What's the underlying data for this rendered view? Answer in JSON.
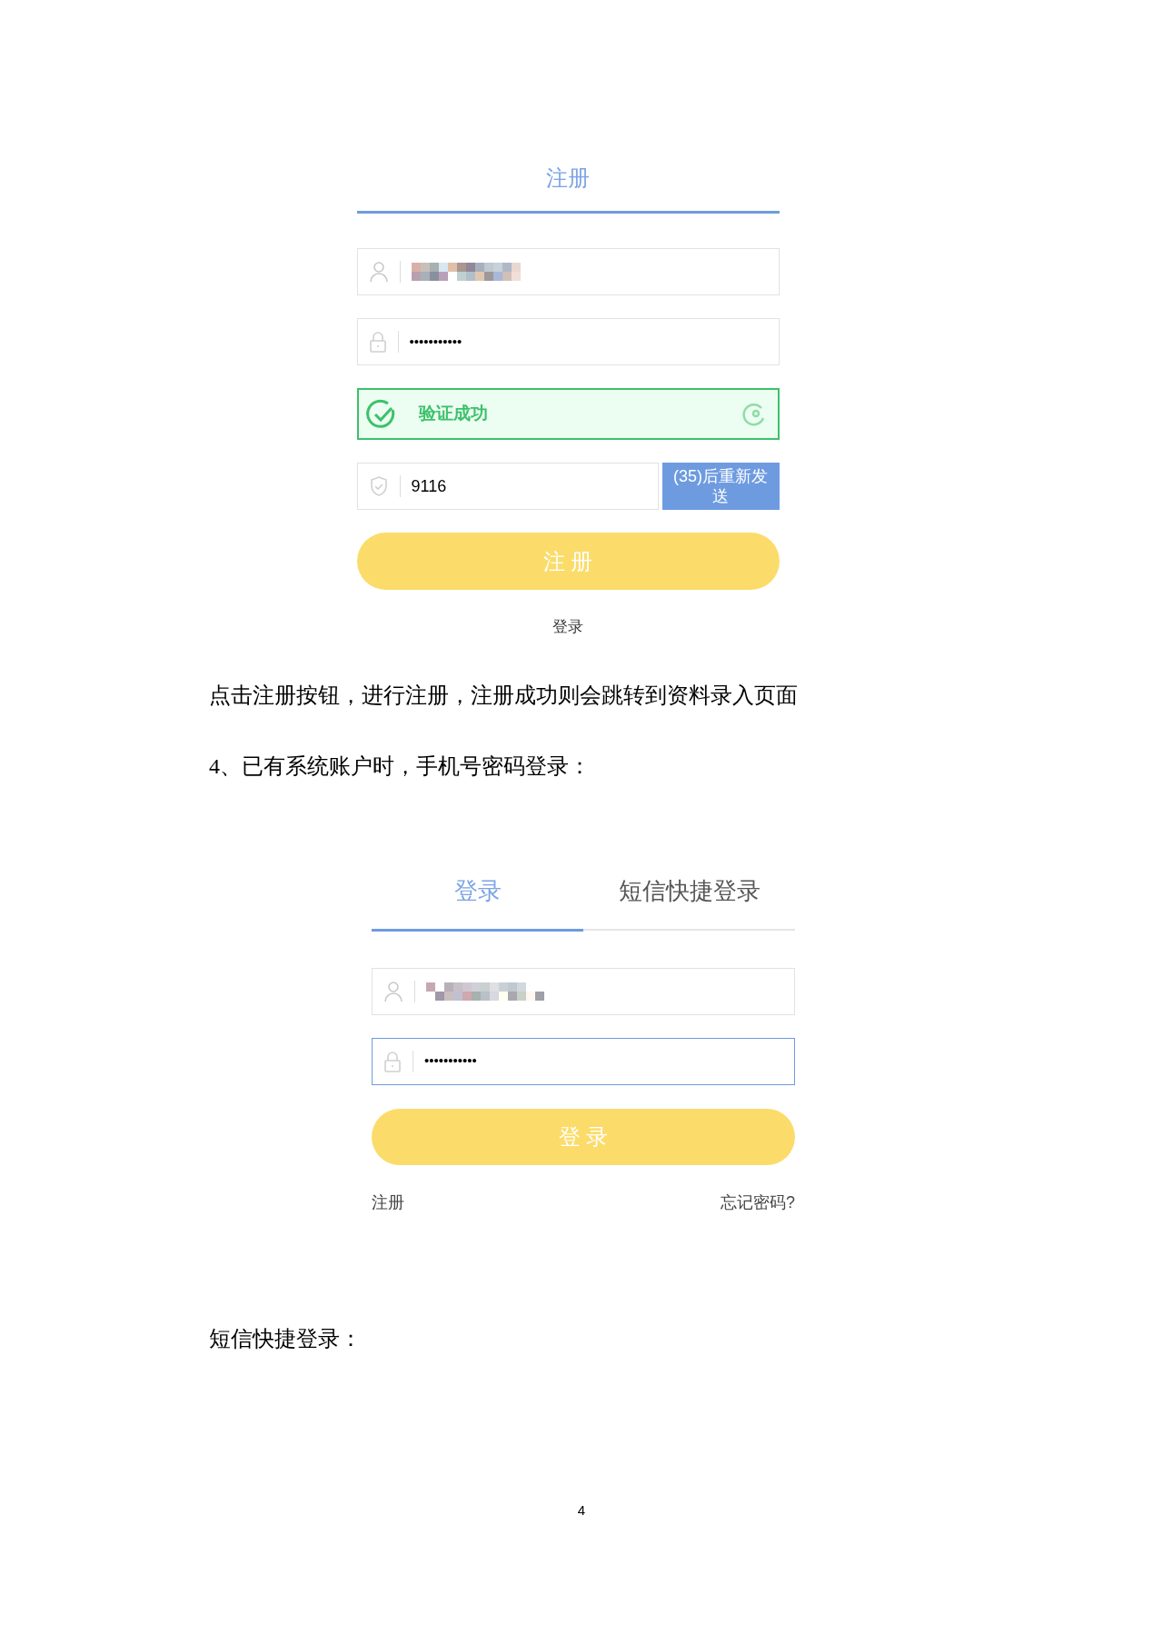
{
  "register_form": {
    "tabs": [
      {
        "label": "注册",
        "selected": true
      }
    ],
    "password": {
      "value": "•••••••••••",
      "focused": false
    },
    "captcha": {
      "label": "验证成功",
      "verified": true
    },
    "sms_code": {
      "value": "9116"
    },
    "resend_button": "(35)后重新发送",
    "submit_button": "注 册",
    "login_link": "登录"
  },
  "paragraphs": [
    "点击注册按钮，进行注册，注册成功则会跳转到资料录入页面",
    "4、已有系统账户时，手机号密码登录："
  ],
  "login_form": {
    "tabs": [
      {
        "label": "登录",
        "selected": true
      },
      {
        "label": "短信快捷登录",
        "selected": false
      }
    ],
    "password": {
      "value": "•••••••••••",
      "focused": true
    },
    "submit_button": "登 录",
    "register_link": "注册",
    "forgot_link": "忘记密码?"
  },
  "closing_text": "短信快捷登录：",
  "page_number": "4"
}
